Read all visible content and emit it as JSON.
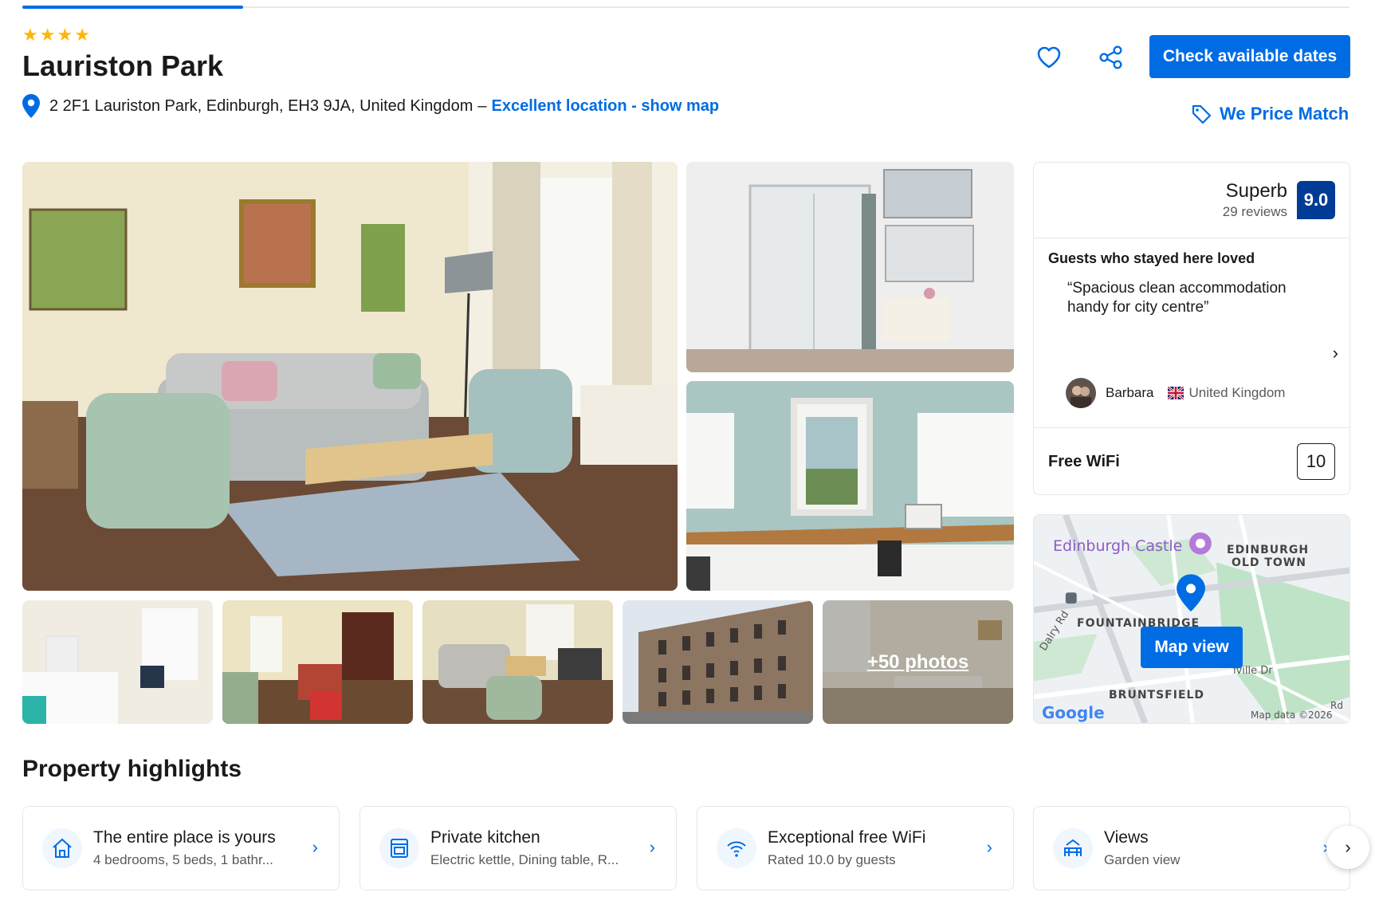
{
  "hotel": {
    "stars": 4,
    "name": "Lauriston Park",
    "address": "2 2F1 Lauriston Park, Edinburgh, EH3 9JA, United Kingdom",
    "address_separator": "–",
    "location_link": "Excellent location - show map"
  },
  "actions": {
    "favorite_icon": "heart-icon",
    "share_icon": "share-icon",
    "check_dates_label": "Check available dates",
    "price_match_label": "We Price Match",
    "price_match_icon": "tag-icon"
  },
  "gallery": {
    "more_photos_label": "+50 photos"
  },
  "review_summary": {
    "rating_word": "Superb",
    "review_count": "29 reviews",
    "score": "9.0",
    "loved_title": "Guests who stayed here loved",
    "quote": "“Spacious clean accommodation handy for city centre”",
    "reviewer_name": "Barbara",
    "reviewer_country": "United Kingdom",
    "wifi_label": "Free WiFi",
    "wifi_score": "10"
  },
  "map": {
    "button_label": "Map view",
    "labels": {
      "castle": "Edinburgh Castle",
      "old_town_1": "EDINBURGH",
      "old_town_2": "OLD TOWN",
      "fountainbridge": "FOUNTAINBRIDGE",
      "dalry": "Dalry Rd",
      "bruntsfield": "BRUNTSFIELD",
      "melville": "lville Dr",
      "google": "Google",
      "map_data": "Map data ©2026",
      "road": "Rd"
    }
  },
  "highlights": {
    "title": "Property highlights",
    "items": [
      {
        "title": "The entire place is yours",
        "subtitle": "4 bedrooms, 5 beds, 1 bathr...",
        "icon": "house-icon"
      },
      {
        "title": "Private kitchen",
        "subtitle": "Electric kettle, Dining table, R...",
        "icon": "oven-icon"
      },
      {
        "title": "Exceptional free WiFi",
        "subtitle": "Rated 10.0 by guests",
        "icon": "wifi-icon"
      },
      {
        "title": "Views",
        "subtitle": "Garden view",
        "icon": "view-icon"
      }
    ]
  },
  "colors": {
    "brand_blue": "#006ce4",
    "score_blue": "#003b95",
    "star_yellow": "#ffb700"
  }
}
